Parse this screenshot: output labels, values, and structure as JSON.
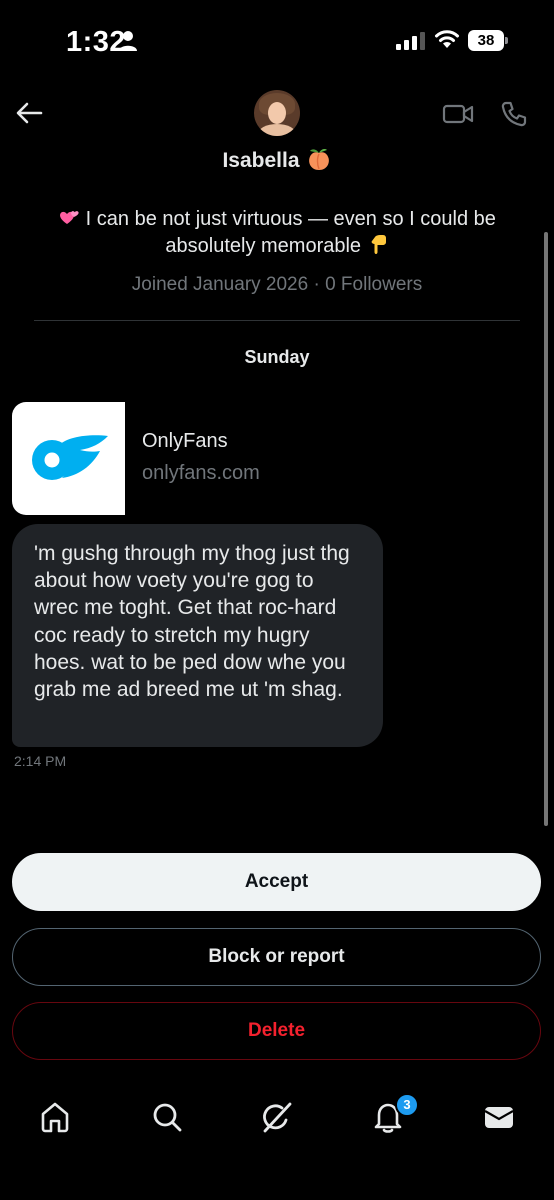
{
  "status_bar": {
    "time": "1:32",
    "battery": "38"
  },
  "header": {
    "name": "Isabella"
  },
  "profile": {
    "bio": "I can be not just virtuous — even so I could be absolutely memorable",
    "joined": "Joined January 2026 · 0 Followers"
  },
  "conversation": {
    "day_label": "Sunday",
    "link_card": {
      "title": "OnlyFans",
      "domain": "onlyfans.com"
    },
    "message": {
      "text": "'m gushg through my thog just thg about how voety you're gog to wrec me toght. Get that roc-hard coc ready to stretch my hugry hoes.  wat to be ped dow whe you grab me ad breed me ut 'm shag.",
      "time": "2:14 PM"
    }
  },
  "actions": {
    "accept": "Accept",
    "block_report": "Block or report",
    "delete": "Delete"
  },
  "bottom_nav": {
    "items": [
      "home-icon",
      "search-icon",
      "grok-icon",
      "bell-icon",
      "mail-icon"
    ],
    "notification_count": "3"
  },
  "colors": {
    "accent": "#1d9bf0",
    "danger": "#f4212e",
    "background": "#000000",
    "bubble": "#202327"
  }
}
